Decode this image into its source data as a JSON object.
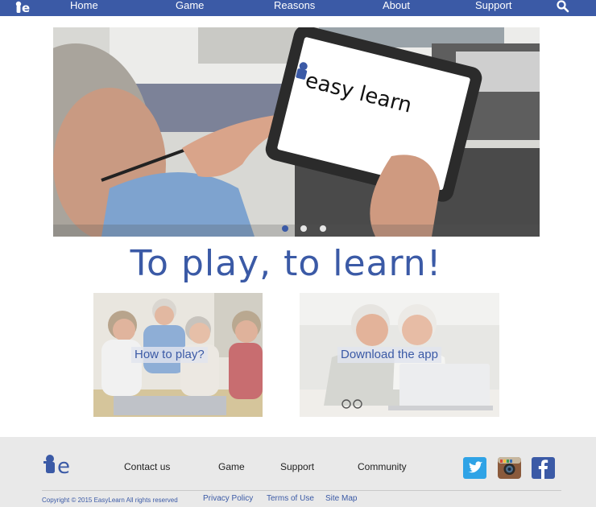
{
  "brand": {
    "logo_text": "e",
    "accent": "#3b5aa6"
  },
  "nav": {
    "items": [
      "Home",
      "Game",
      "Reasons",
      "About",
      "Support"
    ],
    "search_icon": "search-icon"
  },
  "hero": {
    "tablet_text": "easy learn",
    "slide_count": 3,
    "active_slide": 1
  },
  "slogan": "To play, to learn!",
  "cards": [
    {
      "label": "How to play?"
    },
    {
      "label": "Download the app"
    }
  ],
  "footer": {
    "links": [
      "Contact us",
      "Game",
      "Support",
      "Community"
    ],
    "social": [
      {
        "name": "twitter-icon",
        "color": "#2fa3e6"
      },
      {
        "name": "instagram-icon",
        "color": "#8a5a3c"
      },
      {
        "name": "facebook-icon",
        "color": "#3b5aa6"
      }
    ],
    "copyright": "Copyright © 2015 EasyLearn All rights reserved",
    "legal": [
      "Privacy Policy",
      "Terms of Use",
      "Site Map"
    ]
  }
}
